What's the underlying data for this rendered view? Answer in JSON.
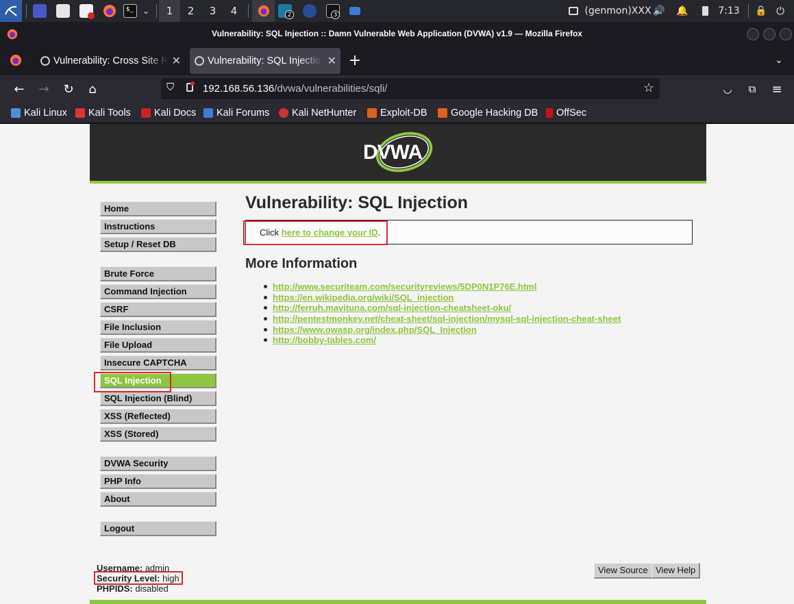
{
  "panel": {
    "workspaces": [
      "1",
      "2",
      "3",
      "4"
    ],
    "task_badges": [
      "2",
      "3"
    ],
    "user_label": "(genmon)XXX",
    "clock": "7:13"
  },
  "window": {
    "title": "Vulnerability: SQL Injection :: Damn Vulnerable Web Application (DVWA) v1.9 — Mozilla Firefox"
  },
  "tabs": [
    {
      "label": "Vulnerability: Cross Site R",
      "selected": false
    },
    {
      "label": "Vulnerability: SQL Injectio",
      "selected": true
    }
  ],
  "navbar": {
    "url_host": "192.168.56.136",
    "url_path": "/dvwa/vulnerabilities/sqli/"
  },
  "bookmarks": [
    {
      "label": "Kali Linux",
      "color": "#4a90d9"
    },
    {
      "label": "Kali Tools",
      "color": "#d33"
    },
    {
      "label": "Kali Docs",
      "color": "#c22"
    },
    {
      "label": "Kali Forums",
      "color": "#3b7dd8"
    },
    {
      "label": "Kali NetHunter",
      "color": "#c33"
    },
    {
      "label": "Exploit-DB",
      "color": "#e0601c"
    },
    {
      "label": "Google Hacking DB",
      "color": "#e0601c"
    },
    {
      "label": "OffSec",
      "color": "#c11"
    }
  ],
  "dvwa": {
    "logo_text": "DVWA",
    "accent": "#8dc63f",
    "menu_groups": [
      [
        "Home",
        "Instructions",
        "Setup / Reset DB"
      ],
      [
        "Brute Force",
        "Command Injection",
        "CSRF",
        "File Inclusion",
        "File Upload",
        "Insecure CAPTCHA",
        "SQL Injection",
        "SQL Injection (Blind)",
        "XSS (Reflected)",
        "XSS (Stored)"
      ],
      [
        "DVWA Security",
        "PHP Info",
        "About"
      ],
      [
        "Logout"
      ]
    ],
    "active_menu": "SQL Injection",
    "page_title": "Vulnerability: SQL Injection",
    "click_prefix": "Click ",
    "change_id_link": "here to change your ID",
    "click_suffix": ".",
    "more_info_title": "More Information",
    "more_info_links": [
      "http://www.securiteam.com/securityreviews/5DP0N1P76E.html",
      "https://en.wikipedia.org/wiki/SQL_injection",
      "http://ferruh.mavituna.com/sql-injection-cheatsheet-oku/",
      "http://pentestmonkey.net/cheat-sheet/sql-injection/mysql-sql-injection-cheat-sheet",
      "https://www.owasp.org/index.php/SQL_Injection",
      "http://bobby-tables.com/"
    ],
    "username_label": "Username:",
    "username_value": " admin",
    "security_label": "Security Level:",
    "security_value": " high",
    "phpids_label": "PHPIDS:",
    "phpids_value": " disabled",
    "view_source": "View Source",
    "view_help": "View Help"
  }
}
